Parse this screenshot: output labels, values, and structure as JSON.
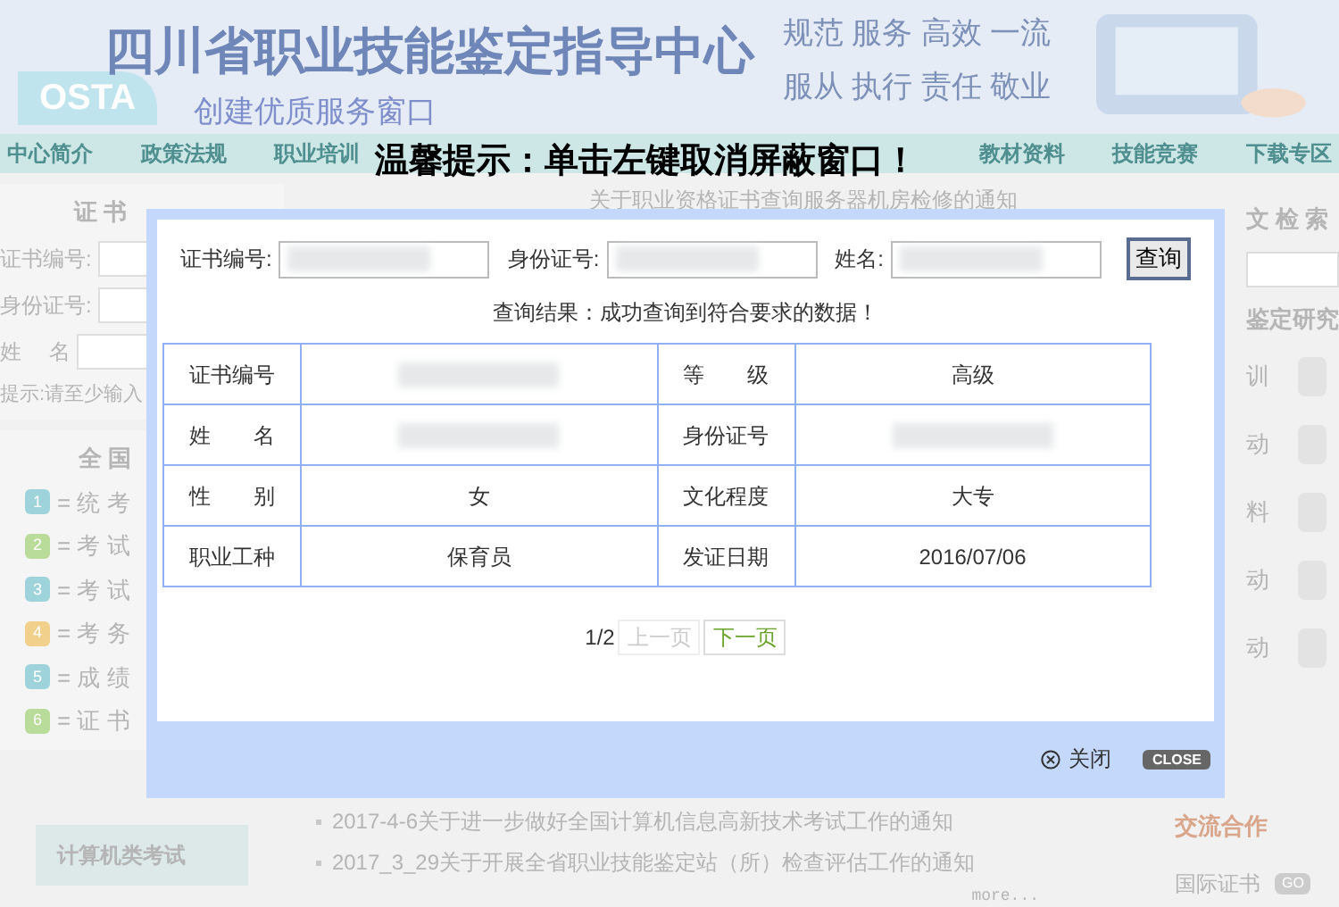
{
  "header": {
    "title": "四川省职业技能鉴定指导中心",
    "slogans": [
      "规范 服务 高效 一流",
      "服从 执行 责任 敬业"
    ],
    "logo": "OSTA",
    "tagline": "创建优质服务窗口"
  },
  "nav": [
    "中心简介",
    "政策法规",
    "职业培训",
    "教材资料",
    "技能竞赛",
    "下载专区"
  ],
  "notice": "温馨提示：单击左键取消屏蔽窗口！",
  "left": {
    "heading": "证 书",
    "fields": [
      "证书编号:",
      "身份证号:",
      "姓　 名"
    ],
    "hint": "提示:请至少输入",
    "legend_title": "全 国",
    "legend": [
      {
        "num": "1",
        "label": "= 统 考",
        "color": "#9fd3dc"
      },
      {
        "num": "2",
        "label": "= 考 试",
        "color": "#b9dc9a"
      },
      {
        "num": "3",
        "label": "= 考 试",
        "color": "#9fd3dc"
      },
      {
        "num": "4",
        "label": "= 考 务",
        "color": "#f0d08a"
      },
      {
        "num": "5",
        "label": "= 成 绩",
        "color": "#9fd3dc"
      },
      {
        "num": "6",
        "label": "= 证 书",
        "color": "#b9dc9a"
      }
    ],
    "tab": "计算机类考试"
  },
  "center": {
    "headline": "关于职业资格证书查询服务器机房检修的通知",
    "news": [
      "2017-4-6关于进一步做好全国计算机信息高新技术考试工作的通知",
      "2017_3_29关于开展全省职业技能鉴定站（所）检查评估工作的通知"
    ],
    "more": "more..."
  },
  "right": {
    "search_title": "文 检 索",
    "research_title": "鉴定研究",
    "items": [
      "训",
      "动",
      "料",
      "动",
      "动"
    ],
    "coop_title": "交流合作",
    "link": "国际证书",
    "go": "GO"
  },
  "modal": {
    "fields": [
      {
        "label": "证书编号:"
      },
      {
        "label": "身份证号:"
      },
      {
        "label": "姓名:"
      }
    ],
    "query_button": "查询",
    "result": "查询结果：成功查询到符合要求的数据！",
    "rows": [
      [
        {
          "text": "证书编号"
        },
        {
          "redacted": true
        },
        {
          "text": "等　　级"
        },
        {
          "text": "高级"
        }
      ],
      [
        {
          "text": "姓　　名"
        },
        {
          "redacted": true
        },
        {
          "text": "身份证号"
        },
        {
          "redacted": true
        }
      ],
      [
        {
          "text": "性　　别"
        },
        {
          "text": "女"
        },
        {
          "text": "文化程度"
        },
        {
          "text": "大专"
        }
      ],
      [
        {
          "text": "职业工种"
        },
        {
          "text": "保育员"
        },
        {
          "text": "发证日期"
        },
        {
          "text": "2016/07/06"
        }
      ]
    ],
    "page": "1/2",
    "pager": [
      {
        "label": "上一页",
        "disabled": true
      },
      {
        "label": "下一页",
        "disabled": false
      }
    ],
    "close": "关闭",
    "close_badge": "CLOSE"
  }
}
